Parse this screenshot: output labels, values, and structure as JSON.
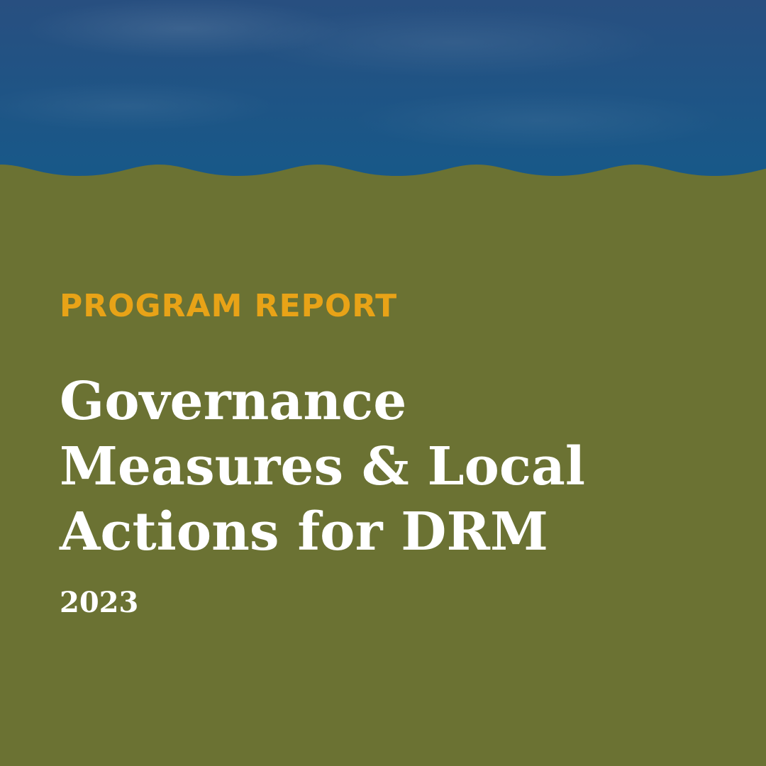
{
  "colors": {
    "sky": "#1f5485",
    "ground": "#6b7233",
    "eyebrow": "#e8a317",
    "text": "#ffffff"
  },
  "cover": {
    "eyebrow": "PROGRAM REPORT",
    "title_lines": [
      "Governance",
      "Measures & Local",
      "Actions for DRM"
    ],
    "year": "2023"
  }
}
